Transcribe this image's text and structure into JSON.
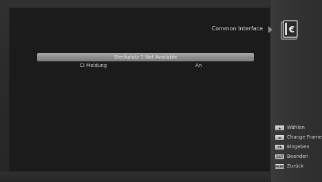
{
  "header": {
    "title": "Common Interface",
    "icon": "common-interface-icon"
  },
  "menu": {
    "selected_item": "Steckplatz 1 Not Available",
    "items": [
      {
        "label": "CI Meldung",
        "value": "An"
      }
    ]
  },
  "help": [
    {
      "key": "▲",
      "label": "Wählen",
      "key_icon": "up-arrow-key-icon"
    },
    {
      "key": "◄►",
      "label": "Change Frame",
      "key_icon": "left-right-key-icon"
    },
    {
      "key": "OK",
      "label": "Eingeben",
      "key_icon": "ok-key-icon"
    },
    {
      "key": "EXIT",
      "label": "Beenden",
      "key_icon": "exit-key-icon"
    },
    {
      "key": "MENU",
      "label": "Zurück",
      "key_icon": "menu-key-icon"
    }
  ],
  "colors": {
    "background": "#1b1b1b",
    "side_panel": "#333333",
    "highlight": "#8c8c8c",
    "text": "#cfcfcf"
  }
}
